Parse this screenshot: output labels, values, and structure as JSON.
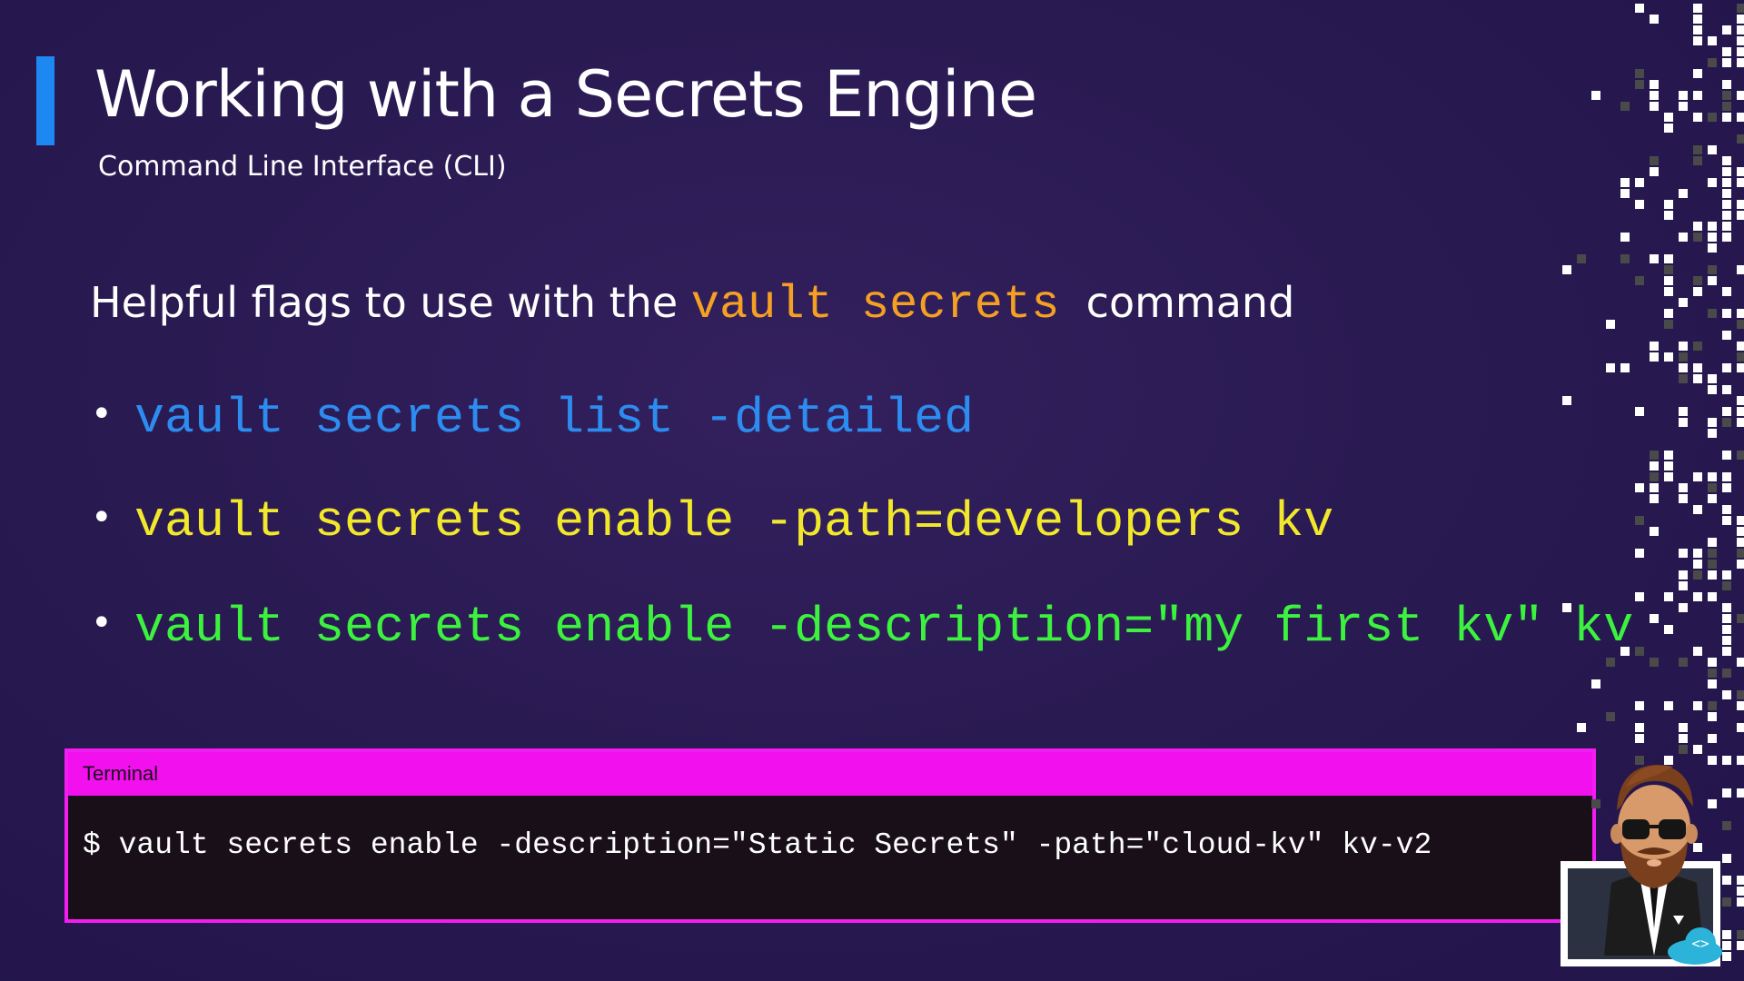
{
  "slide": {
    "title": "Working with a Secrets Engine",
    "subtitle": "Command Line Interface (CLI)",
    "intro": {
      "text_before": "Helpful flags to use with the ",
      "code": "vault secrets",
      "text_after": "command"
    },
    "bullets": [
      {
        "text": "vault secrets list -detailed",
        "color": "#2d8cf0"
      },
      {
        "text": "vault secrets enable -path=developers kv",
        "color": "#f2e82b"
      },
      {
        "text": "vault secrets enable -description=\"my first kv\" kv",
        "color": "#3cf23f"
      }
    ],
    "bullet_symbol": "•"
  },
  "terminal": {
    "title": "Terminal",
    "command": "$ vault secrets enable -description=\"Static Secrets\" -path=\"cloud-kv\" kv-v2"
  },
  "colors": {
    "accent": "#1e88f2",
    "background": "#2a1a52",
    "code_orange": "#f5a023",
    "terminal_border": "#f21df0"
  },
  "icons": [
    "instructor-avatar",
    "code-cloud-logo",
    "pixel-dots-decoration"
  ]
}
